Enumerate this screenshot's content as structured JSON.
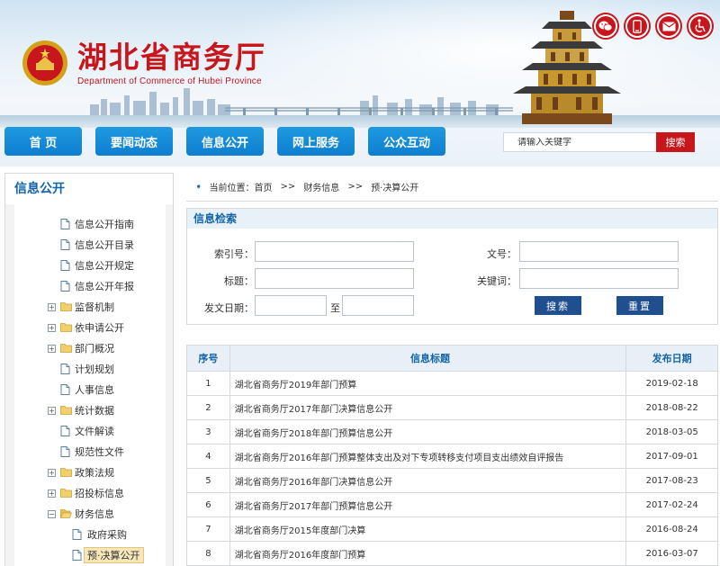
{
  "header": {
    "site_title": "湖北省商务厅",
    "site_subtitle": "Department of Commerce of Hubei Province",
    "tools": [
      {
        "icon": "wechat-icon"
      },
      {
        "icon": "mobile-icon"
      },
      {
        "icon": "mail-icon"
      },
      {
        "icon": "accessibility-icon"
      }
    ],
    "nav": [
      {
        "label": "首 页"
      },
      {
        "label": "要闻动态"
      },
      {
        "label": "信息公开"
      },
      {
        "label": "网上服务"
      },
      {
        "label": "公众互动"
      }
    ],
    "search": {
      "placeholder": "请输入关键字",
      "button": "搜索"
    },
    "colors": {
      "brand_red": "#c8161d",
      "nav_blue": "#0d7ed0",
      "title_blue": "#1164a8"
    }
  },
  "sidebar": {
    "title": "信息公开",
    "items": [
      {
        "label": "信息公开指南",
        "type": "doc"
      },
      {
        "label": "信息公开目录",
        "type": "doc"
      },
      {
        "label": "信息公开规定",
        "type": "doc"
      },
      {
        "label": "信息公开年报",
        "type": "doc"
      },
      {
        "label": "监督机制",
        "type": "folder"
      },
      {
        "label": "依申请公开",
        "type": "folder"
      },
      {
        "label": "部门概况",
        "type": "folder"
      },
      {
        "label": "计划规划",
        "type": "doc"
      },
      {
        "label": "人事信息",
        "type": "doc"
      },
      {
        "label": "统计数据",
        "type": "folder"
      },
      {
        "label": "文件解读",
        "type": "doc"
      },
      {
        "label": "规范性文件",
        "type": "doc"
      },
      {
        "label": "政策法规",
        "type": "folder"
      },
      {
        "label": "招投标信息",
        "type": "folder"
      },
      {
        "label": "财务信息",
        "type": "folder-open"
      },
      {
        "label": "政府采购",
        "type": "sub-doc"
      },
      {
        "label": "预·决算公开",
        "type": "sub-doc-active"
      }
    ]
  },
  "breadcrumb": {
    "prefix": "当前位置：",
    "items": [
      "首页",
      "财务信息",
      "预·决算公开"
    ],
    "sep": ">>"
  },
  "search_panel": {
    "title": "信息检索",
    "index_label": "索引号：",
    "docno_label": "文号：",
    "title_label": "标题：",
    "keyword_label": "关键词：",
    "date_label": "发文日期：",
    "date_to": "至",
    "search_button": "搜索",
    "reset_button": "重置"
  },
  "table": {
    "headers": [
      "序号",
      "信息标题",
      "发布日期"
    ],
    "rows": [
      {
        "no": "1",
        "title": "湖北省商务厅2019年部门预算",
        "date": "2019-02-18"
      },
      {
        "no": "2",
        "title": "湖北省商务厅2017年部门决算信息公开",
        "date": "2018-08-22"
      },
      {
        "no": "3",
        "title": "湖北省商务厅2018年部门预算信息公开",
        "date": "2018-03-05"
      },
      {
        "no": "4",
        "title": "湖北省商务厅2016年部门预算整体支出及对下专项转移支付项目支出绩效自评报告",
        "date": "2017-09-01"
      },
      {
        "no": "5",
        "title": "湖北省商务厅2016年部门决算信息公开",
        "date": "2017-08-23"
      },
      {
        "no": "6",
        "title": "湖北省商务厅2017年部门预算信息公开",
        "date": "2017-02-24"
      },
      {
        "no": "7",
        "title": "湖北省商务厅2015年度部门决算",
        "date": "2016-08-24"
      },
      {
        "no": "8",
        "title": "湖北省商务厅2016年度部门预算",
        "date": "2016-03-07"
      }
    ]
  }
}
